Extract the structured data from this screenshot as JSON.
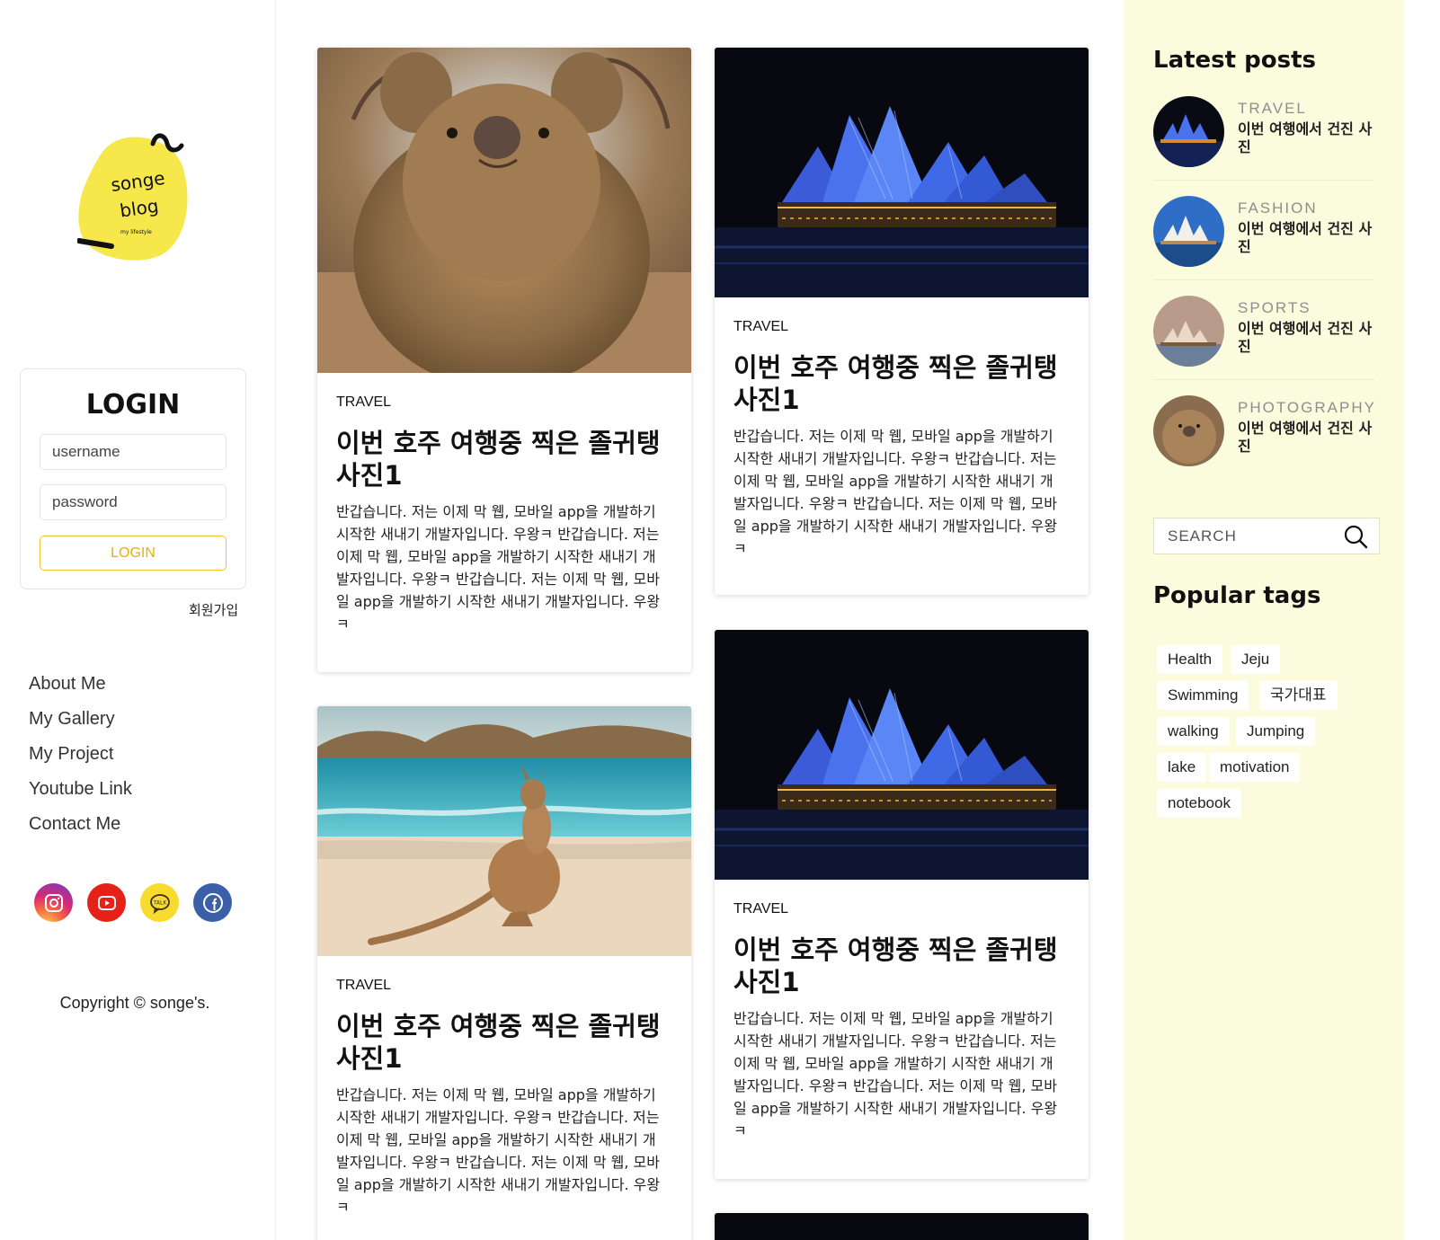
{
  "sidebar": {
    "logo": {
      "line1": "songe",
      "line2": "blog",
      "tagline": "my lifestyle"
    },
    "login": {
      "title": "LOGIN",
      "username_placeholder": "username",
      "password_placeholder": "password",
      "button_label": "LOGIN",
      "signup_label": "회원가입"
    },
    "nav": [
      "About Me",
      "My Gallery",
      "My Project",
      "Youtube Link",
      "Contact Me"
    ],
    "socials": [
      {
        "name": "instagram-icon",
        "color": "#d62976"
      },
      {
        "name": "youtube-icon",
        "color": "#e62117"
      },
      {
        "name": "kakaotalk-icon",
        "color": "#f8dc2d",
        "label": "TALK"
      },
      {
        "name": "facebook-icon",
        "color": "#3b5fa9"
      }
    ],
    "copyright": "Copyright © songe's."
  },
  "posts": [
    {
      "image": "quokka-photo",
      "category": "TRAVEL",
      "title": "이번 호주 여행중 찍은 졸귀탱 사진1",
      "body": "반갑습니다. 저는 이제 막 웹, 모바일 app을 개발하기 시작한 새내기 개발자입니다. 우왕ㅋ 반갑습니다. 저는 이제 막 웹, 모바일 app을 개발하기 시작한 새내기 개발자입니다. 우왕ㅋ 반갑습니다. 저는 이제 막 웹, 모바일 app을 개발하기 시작한 새내기 개발자입니다. 우왕ㅋ"
    },
    {
      "image": "opera-house-night-photo",
      "category": "TRAVEL",
      "title": "이번 호주 여행중 찍은 졸귀탱 사진1",
      "body": "반갑습니다. 저는 이제 막 웹, 모바일 app을 개발하기 시작한 새내기 개발자입니다. 우왕ㅋ 반갑습니다. 저는 이제 막 웹, 모바일 app을 개발하기 시작한 새내기 개발자입니다. 우왕ㅋ 반갑습니다. 저는 이제 막 웹, 모바일 app을 개발하기 시작한 새내기 개발자입니다. 우왕ㅋ"
    },
    {
      "image": "kangaroo-beach-photo",
      "category": "TRAVEL",
      "title": "이번 호주 여행중 찍은 졸귀탱 사진1",
      "body": "반갑습니다. 저는 이제 막 웹, 모바일 app을 개발하기 시작한 새내기 개발자입니다. 우왕ㅋ 반갑습니다. 저는 이제 막 웹, 모바일 app을 개발하기 시작한 새내기 개발자입니다. 우왕ㅋ 반갑습니다. 저는 이제 막 웹, 모바일 app을 개발하기 시작한 새내기 개발자입니다. 우왕ㅋ"
    },
    {
      "image": "opera-house-night-photo",
      "category": "TRAVEL",
      "title": "이번 호주 여행중 찍은 졸귀탱 사진1",
      "body": "반갑습니다. 저는 이제 막 웹, 모바일 app을 개발하기 시작한 새내기 개발자입니다. 우왕ㅋ 반갑습니다. 저는 이제 막 웹, 모바일 app을 개발하기 시작한 새내기 개발자입니다. 우왕ㅋ 반갑습니다. 저는 이제 막 웹, 모바일 app을 개발하기 시작한 새내기 개발자입니다. 우왕ㅋ"
    }
  ],
  "right": {
    "latest_title": "Latest posts",
    "latest": [
      {
        "category": "TRAVEL",
        "title": "이번 여행에서 건진 사진",
        "thumb": "opera-house-night-thumb"
      },
      {
        "category": "FASHION",
        "title": "이번 여행에서 건진 사진",
        "thumb": "opera-house-day-thumb"
      },
      {
        "category": "SPORTS",
        "title": "이번 여행에서 건진 사진",
        "thumb": "opera-house-sunset-thumb"
      },
      {
        "category": "PHOTOGRAPHY",
        "title": "이번 여행에서 건진 사진",
        "thumb": "quokka-thumb"
      }
    ],
    "search_placeholder": "SEARCH",
    "tags_title": "Popular tags",
    "tags": [
      "Health",
      "Jeju",
      "Swimming",
      "국가대표",
      "walking",
      "Jumping",
      "lake",
      "motivation",
      "notebook"
    ]
  },
  "colors": {
    "accent_yellow": "#f6e84b",
    "sidebar_bg": "#fbfbdd",
    "login_button": "#e5b10c"
  }
}
